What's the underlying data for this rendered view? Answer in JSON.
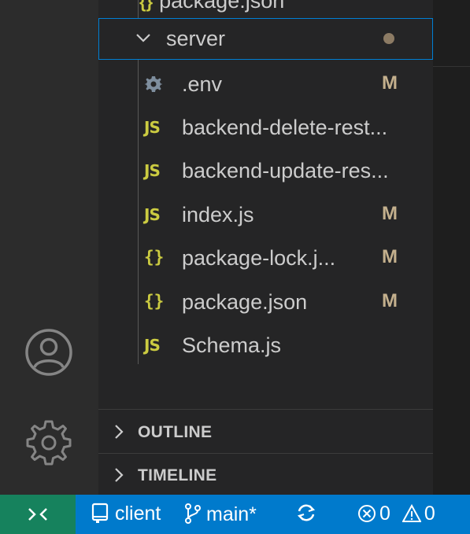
{
  "explorer": {
    "partial_top_item": {
      "icon": "json-braces-icon",
      "name": "package.json"
    },
    "folder": {
      "name": "server",
      "status": "modified-dot"
    },
    "files": [
      {
        "icon": "gear-icon",
        "name": ".env",
        "status": "M"
      },
      {
        "icon": "js-icon",
        "name": "backend-delete-rest...",
        "status": ""
      },
      {
        "icon": "js-icon",
        "name": "backend-update-res...",
        "status": ""
      },
      {
        "icon": "js-icon",
        "name": "index.js",
        "status": "M"
      },
      {
        "icon": "json-braces-icon",
        "name": "package-lock.j...",
        "status": "M"
      },
      {
        "icon": "json-braces-icon",
        "name": "package.json",
        "status": "M"
      },
      {
        "icon": "js-icon",
        "name": "Schema.js",
        "status": ""
      }
    ]
  },
  "panels": {
    "outline": "OUTLINE",
    "timeline": "TIMELINE"
  },
  "activity_bar": {
    "account": "account-icon",
    "settings": "settings-gear-icon"
  },
  "status_bar": {
    "workspace": "client",
    "branch": "main*",
    "errors": "0",
    "warnings": "0"
  },
  "icons": {
    "js_label": "JS",
    "json_label": "{}"
  },
  "colors": {
    "status_bar": "#007acc",
    "remote": "#16825d",
    "focus_border": "#007fd4",
    "modified": "#c4b08d",
    "js_icon": "#cbcb41"
  }
}
